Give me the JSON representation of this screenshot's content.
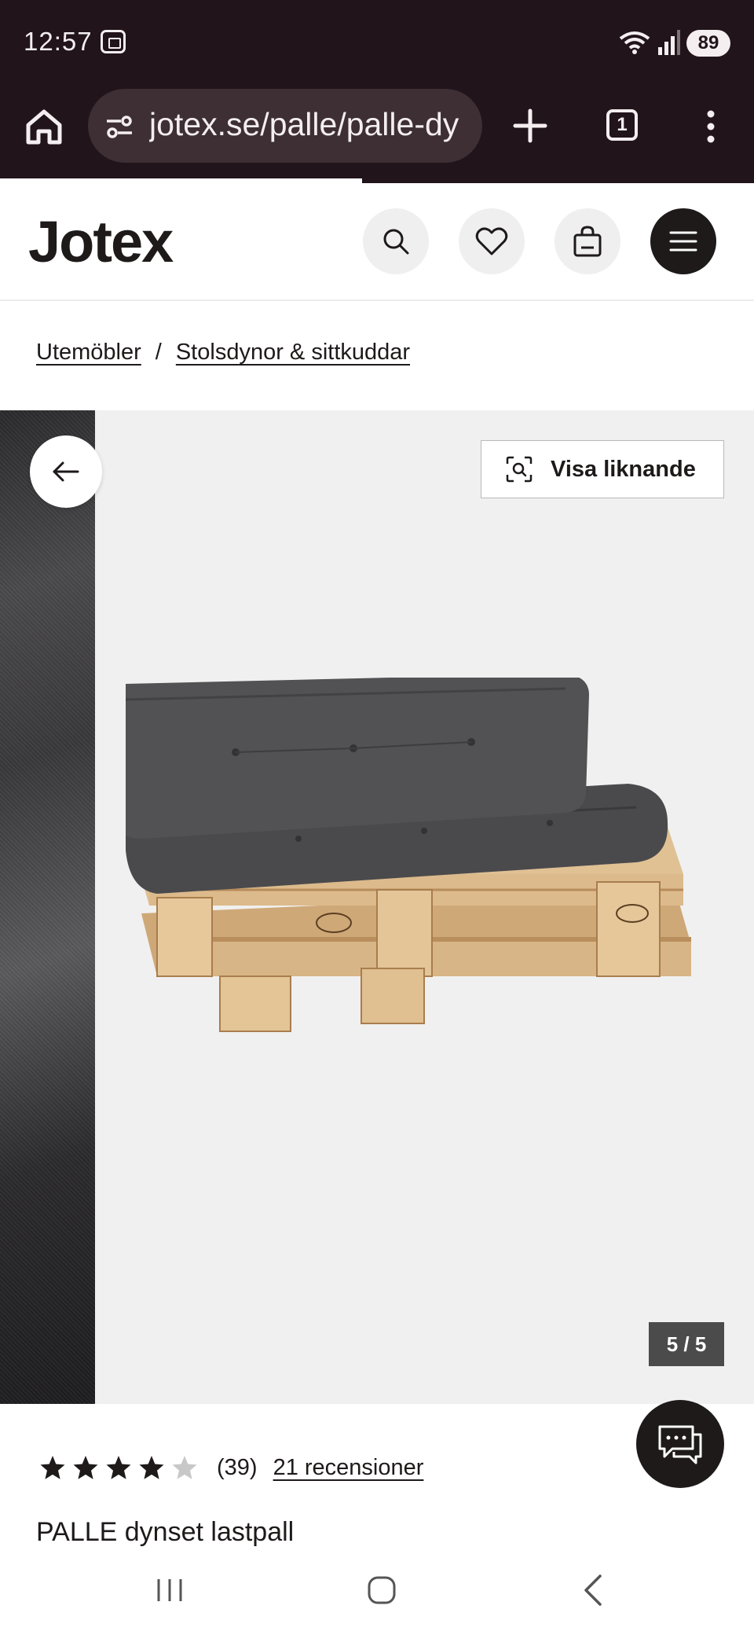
{
  "status_bar": {
    "time": "12:57",
    "battery": "89"
  },
  "browser": {
    "url": "jotex.se/palle/palle-dy",
    "tab_count": "1"
  },
  "header": {
    "logo": "Jotex"
  },
  "breadcrumb": {
    "items": [
      "Utemöbler",
      "Stolsdynor & sittkuddar"
    ],
    "separator": "/"
  },
  "gallery": {
    "similar_label": "Visa liknande",
    "counter": "5 / 5"
  },
  "product": {
    "rating": 4,
    "rating_max": 5,
    "rating_count": "(39)",
    "reviews_link": "21 recensioner",
    "title": "PALLE dynset lastpall"
  },
  "colors": {
    "chrome_bg": "#21141a",
    "urlbar_bg": "#3d2f34",
    "brand_dark": "#1e1a1a",
    "gallery_bg": "#f0f0f0",
    "cushion": "#4a4a4d",
    "pallet_wood": "#d9b68a"
  },
  "icons": {
    "home": "home-icon",
    "site_settings": "tune-icon",
    "new_tab": "plus-icon",
    "tabs": "tab-switcher-icon",
    "overflow": "more-vert-icon",
    "search": "search-icon",
    "favorites": "heart-icon",
    "cart": "shopping-bag-icon",
    "menu": "hamburger-icon",
    "back_arrow": "arrow-left-icon",
    "visual_search": "scan-icon",
    "chat": "chat-icon"
  }
}
